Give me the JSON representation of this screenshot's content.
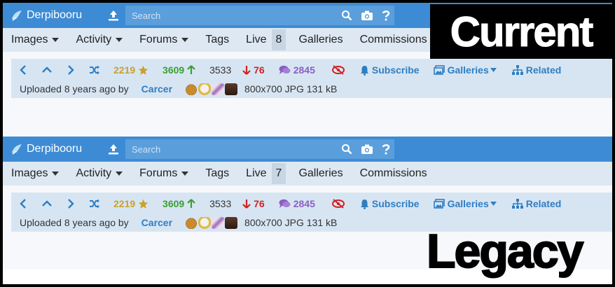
{
  "panels": [
    {
      "site_name": "Derpibooru",
      "search_placeholder": "Search",
      "nav": [
        "Images",
        "Activity",
        "Forums",
        "Tags",
        "Live"
      ],
      "live_count": "8",
      "nav_after": [
        "Galleries",
        "Commissions"
      ],
      "stats": {
        "faves": "2219",
        "upvotes": "3609",
        "score": "3533",
        "downvotes": "76",
        "comments": "2845",
        "subscribe": "Subscribe",
        "galleries": "Galleries",
        "related": "Related"
      },
      "uploaded_prefix": "Uploaded 8 years ago by",
      "uploader": "Carcer",
      "image_info": "800x700 JPG 131 kB"
    },
    {
      "site_name": "Derpibooru",
      "search_placeholder": "Search",
      "nav": [
        "Images",
        "Activity",
        "Forums",
        "Tags",
        "Live"
      ],
      "live_count": "7",
      "nav_after": [
        "Galleries",
        "Commissions"
      ],
      "stats": {
        "faves": "2219",
        "upvotes": "3609",
        "score": "3533",
        "downvotes": "76",
        "comments": "2845",
        "subscribe": "Subscribe",
        "galleries": "Galleries",
        "related": "Related"
      },
      "uploaded_prefix": "Uploaded 8 years ago by",
      "uploader": "Carcer",
      "image_info": "800x700 JPG 131 kB"
    }
  ],
  "captions": {
    "current": "Current",
    "legacy": "Legacy"
  },
  "colors": {
    "header": "#3d8bd4",
    "navbar": "#dde8f3",
    "infobar": "#d7e5f3",
    "faves": "#c9a227",
    "upvotes": "#3ba031",
    "downvotes": "#d12121",
    "comments": "#8b5fc3",
    "link": "#2f7ec2"
  },
  "icons": [
    "logo-icon",
    "upload-icon",
    "search-icon",
    "camera-icon",
    "help-icon",
    "chevron-left-icon",
    "chevron-up-icon",
    "chevron-right-icon",
    "shuffle-icon",
    "star-icon",
    "arrow-up-icon",
    "arrow-down-icon",
    "comments-icon",
    "eye-slash-icon",
    "bell-icon",
    "images-icon",
    "sitemap-icon"
  ]
}
